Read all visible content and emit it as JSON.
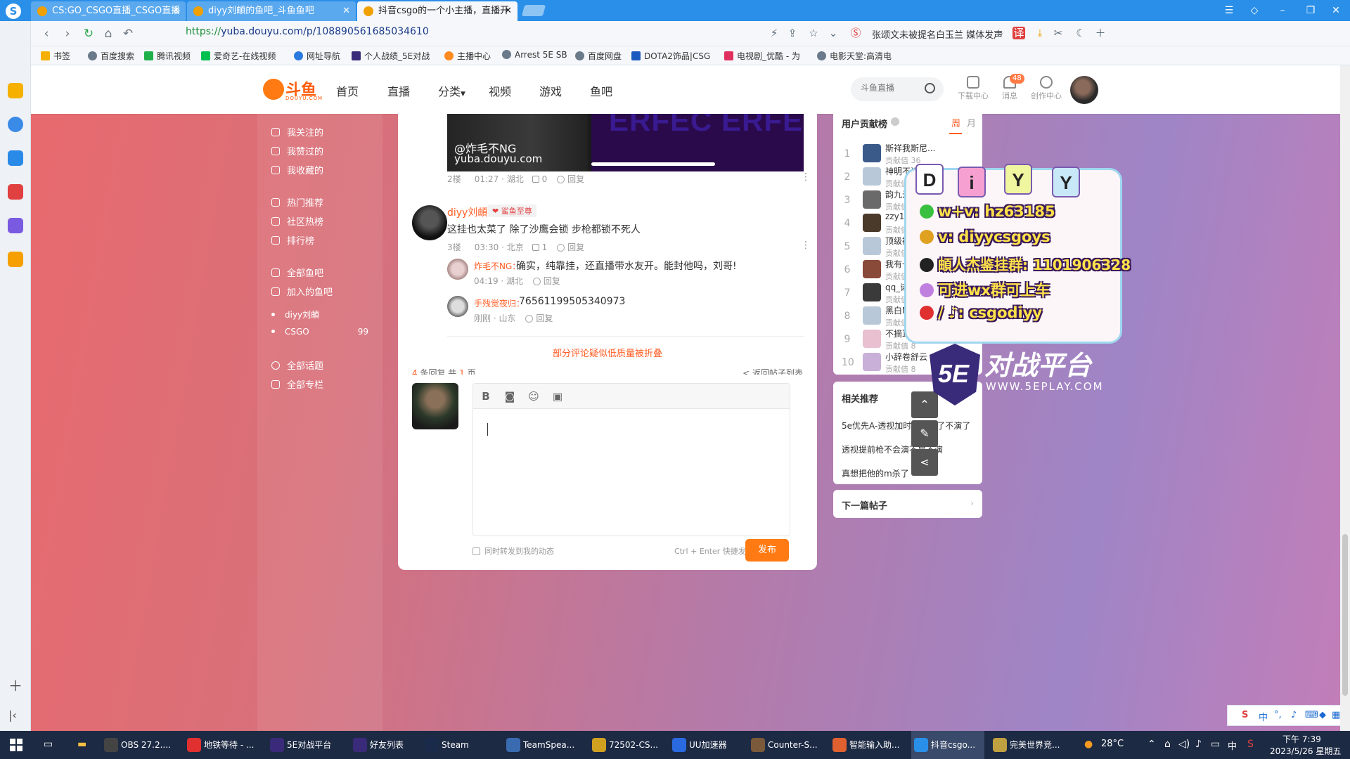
{
  "browser": {
    "tabs": [
      {
        "title": "CS:GO_CSGO直播_CSGO直播"
      },
      {
        "title": "diyy刘頔的鱼吧_斗鱼鱼吧"
      },
      {
        "title": "抖音csgo的一个小主播，直播开"
      }
    ],
    "url": {
      "protocol": "https://",
      "rest": "yuba.douyu.com/p/1088905616850346​10"
    },
    "news_headline": "张颂文未被提名白玉兰 媒体发声",
    "bookmarks": [
      "书签",
      "百度搜索",
      "腾讯视频",
      "爱奇艺-在线视频",
      "网址导航",
      "个人战绩_5E对战",
      "主播中心",
      "Arrest 5E SB",
      "百度网盘",
      "DOTA2饰品|CSG",
      "电视剧_优酷 - 为",
      "电影天堂:高清电"
    ],
    "colors": {
      "tabbar": "#2a8fe8",
      "accent": "#ff5d23"
    }
  },
  "site": {
    "logo_text": "斗鱼",
    "logo_sub": "DOUYU.COM",
    "nav": [
      "首页",
      "直播",
      "分类",
      "视频",
      "游戏",
      "鱼吧"
    ],
    "search_placeholder": "斗鱼直播",
    "tools": [
      {
        "label": "下载中心",
        "icon": "download-icon"
      },
      {
        "label": "消息",
        "icon": "bell-icon"
      },
      {
        "label": "创作中心",
        "icon": "bulb-icon"
      }
    ],
    "message_badge": "48"
  },
  "sidebar": {
    "items": [
      "我关注的",
      "我赞过的",
      "我收藏的",
      "热门推荐",
      "社区热榜",
      "排行榜",
      "全部鱼吧",
      "加入的鱼吧"
    ],
    "joined": [
      {
        "name": "diyy刘頔",
        "count": ""
      },
      {
        "name": "CSGO",
        "count": "99"
      }
    ],
    "bottom": [
      "全部话题",
      "全部专栏"
    ]
  },
  "post": {
    "video_watermark_name": "@炸毛不NG",
    "video_watermark_url": "yuba.douyu.com",
    "video_overlay_text": "ERFEC ERFEC",
    "floor2": {
      "floor": "2楼",
      "time": "01:27",
      "location": "湖北",
      "likes": "0",
      "reply_label": "回复"
    },
    "floor3": {
      "author": "diyy刘頔",
      "badge": "鲨鱼至尊",
      "text": "这挂也太菜了 除了沙鹰会锁 步枪都锁不死人",
      "floor": "3楼",
      "time": "03:30",
      "location": "北京",
      "likes": "1",
      "reply_label": "回复"
    },
    "sub_replies": [
      {
        "author": "炸毛不NG",
        "text": "确实，纯靠挂，还直播带水友开。能封他吗，刘哥!",
        "time": "04:19",
        "location": "湖北",
        "reply_label": "回复"
      },
      {
        "author": "手残觉夜归",
        "text": "76561199505340973",
        "time": "刚刚",
        "location": "山东",
        "reply_label": "回复"
      }
    ],
    "folded_note": "部分评论疑似低质量被折叠",
    "pagination": {
      "count": "4",
      "count_suffix": "条回复 共",
      "pages": "1",
      "pages_suffix": "页"
    },
    "back_link": "< 返回帖子列表"
  },
  "editor": {
    "tools": [
      "bold-icon",
      "camera-icon",
      "emoji-icon",
      "image-icon"
    ],
    "sync_label": "同时转发到我的动态",
    "shortcut_hint": "Ctrl + Enter 快捷发布",
    "publish_label": "发布"
  },
  "ranking": {
    "title": "用户贡献榜",
    "tab_week": "周",
    "tab_month": "月",
    "rows": [
      {
        "rank": "1",
        "name": "斯祥我斯尼...",
        "score": "贡献值 36"
      },
      {
        "rank": "2",
        "name": "神明不诉疾苦1",
        "score": "贡献值 20"
      },
      {
        "rank": "3",
        "name": "韵九云",
        "score": "贡献值 14"
      },
      {
        "rank": "4",
        "name": "zzy1512",
        "score": "贡献值 13"
      },
      {
        "rank": "5",
        "name": "顶级裤李子",
        "score": "贡献值 12"
      },
      {
        "rank": "6",
        "name": "我有一个宝...",
        "score": "贡献值 12"
      },
      {
        "rank": "7",
        "name": "qq_诺诺酱",
        "score": "贡献值 8"
      },
      {
        "rank": "8",
        "name": "黑白Mari",
        "score": "贡献值 8"
      },
      {
        "rank": "9",
        "name": "不摘耳机",
        "score": "贡献值 8"
      },
      {
        "rank": "10",
        "name": "小辞卷舒云",
        "score": "贡献值 8"
      }
    ],
    "pager": "‹  ›"
  },
  "related": {
    "title": "相关推荐",
    "items": [
      "5e优先A-透视加时最后急了不演了",
      "透视提前枪不会演不是不演",
      "真想把他的m杀了"
    ]
  },
  "next_post": {
    "label": "下一篇帖子",
    "arrow": "›"
  },
  "overlay": {
    "tags": [
      "D",
      "i",
      "Y",
      "Y"
    ],
    "lines": [
      {
        "text": "w+v: hz63185",
        "icon": "wechat-icon"
      },
      {
        "text": "v: diyycsgoys",
        "icon": "key-icon"
      },
      {
        "text": "頔人杰鉴挂群: 1101906328",
        "icon": "qq-icon"
      },
      {
        "text": "可进wx群可上车",
        "icon": "badge-icon"
      },
      {
        "text": "/ ♪: csgodiyy",
        "icon": "weibo-icon"
      }
    ],
    "brand_logo": "5E",
    "brand_title": "对战平台",
    "brand_url": "WWW.5EPLAY.COM"
  },
  "taskbar": {
    "apps": [
      "OBS 27.2....",
      "地铁等待 - ...",
      "5E对战平台",
      "好友列表",
      "Steam",
      "TeamSpea...",
      "72502-CS...",
      "UU加速器",
      "Counter-S...",
      "智能输入助...",
      "抖音csgo...",
      "完美世界竞..."
    ],
    "weather": "28°C",
    "ime": "中",
    "time": "下午 7:39",
    "date": "2023/5/26 星期五"
  }
}
